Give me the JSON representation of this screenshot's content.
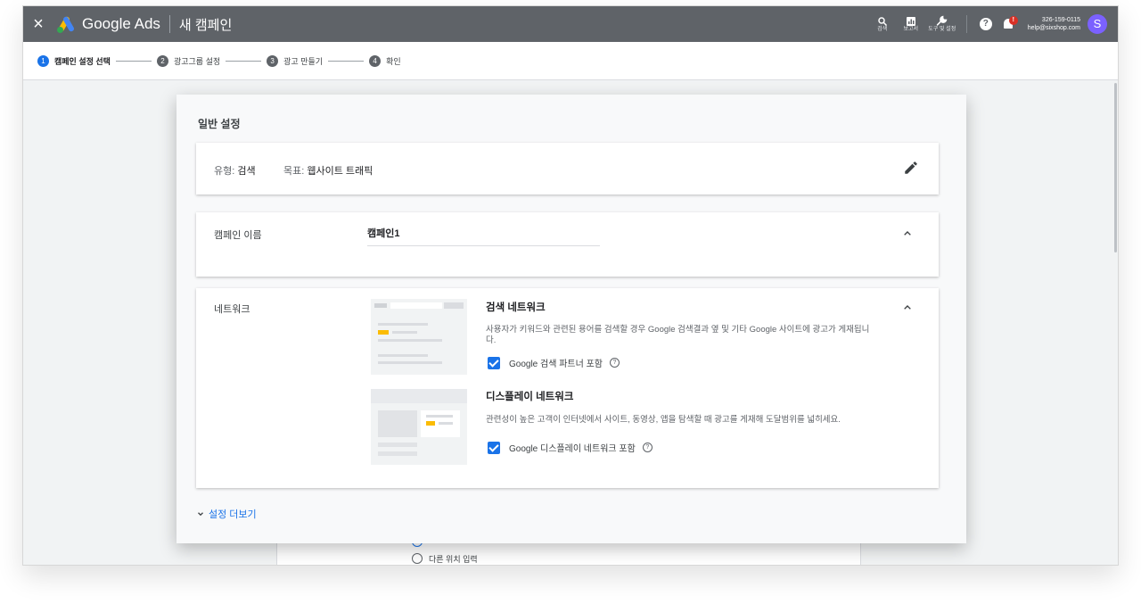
{
  "header": {
    "brand": "Google Ads",
    "page_title": "새 캠페인",
    "tools": [
      {
        "name": "search",
        "label": "검색"
      },
      {
        "name": "reports",
        "label": "보고서"
      },
      {
        "name": "tools-settings",
        "label": "도구 및 설정"
      }
    ],
    "notification_badge": "!",
    "account_id": "326-159-0115",
    "account_email": "help@sixshop.com",
    "avatar_letter": "S"
  },
  "steps": [
    {
      "number": "1",
      "label": "캠페인 설정 선택"
    },
    {
      "number": "2",
      "label": "광고그룹 설정"
    },
    {
      "number": "3",
      "label": "광고 만들기"
    },
    {
      "number": "4",
      "label": "확인"
    }
  ],
  "background": {
    "radio_label": "다른 위치 입력"
  },
  "settings": {
    "title": "일반 설정",
    "type_key": "유형:",
    "type_value": "검색",
    "goal_key": "목표:",
    "goal_value": "웹사이트 트래픽",
    "campaign_name_label": "캠페인 이름",
    "campaign_name_value": "캠페인1",
    "network_label": "네트워크",
    "search_network": {
      "title": "검색 네트워크",
      "description": "사용자가 키워드와 관련된 용어를 검색할 경우 Google 검색결과 옆 및 기타 Google 사이트에 광고가 게재됩니다.",
      "checkbox_label": "Google 검색 파트너 포함"
    },
    "display_network": {
      "title": "디스플레이 네트워크",
      "description": "관련성이 높은 고객이 인터넷에서 사이트, 동영상, 앱을 탐색할 때 광고를 게재해 도달범위를 넓히세요.",
      "checkbox_label": "Google 디스플레이 네트워크 포함"
    },
    "more_settings": "설정 더보기"
  },
  "colors": {
    "topbar": "#5f6368",
    "accent": "#1a73e8",
    "active_step": "#1a73e8",
    "badge": "#d93025",
    "avatar": "#7b61ff"
  }
}
